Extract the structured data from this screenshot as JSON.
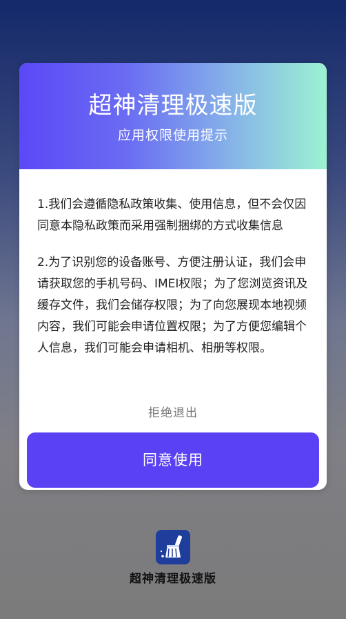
{
  "dialog": {
    "title": "超神清理极速版",
    "subtitle": "应用权限使用提示",
    "paragraphs": [
      "1.我们会遵循隐私政策收集、使用信息，但不会仅因同意本隐私政策而采用强制捆绑的方式收集信息",
      "2.为了识别您的设备账号、方便注册认证，我们会申请获取您的手机号码、IMEI权限；为了您浏览资讯及缓存文件，我们会储存权限；为了向您展现本地视频内容，我们可能会申请位置权限；为了方便您编辑个人信息，我们可能会申请相机、相册等权限。"
    ],
    "reject_label": "拒绝退出",
    "agree_label": "同意使用"
  },
  "footer": {
    "app_name": "超神清理极速版",
    "logo_icon": "broom-icon"
  },
  "colors": {
    "header_gradient_start": "#5b48f6",
    "header_gradient_end": "#9df2d2",
    "agree_button": "#5a41f3",
    "logo_bg": "#1f3d9a"
  }
}
